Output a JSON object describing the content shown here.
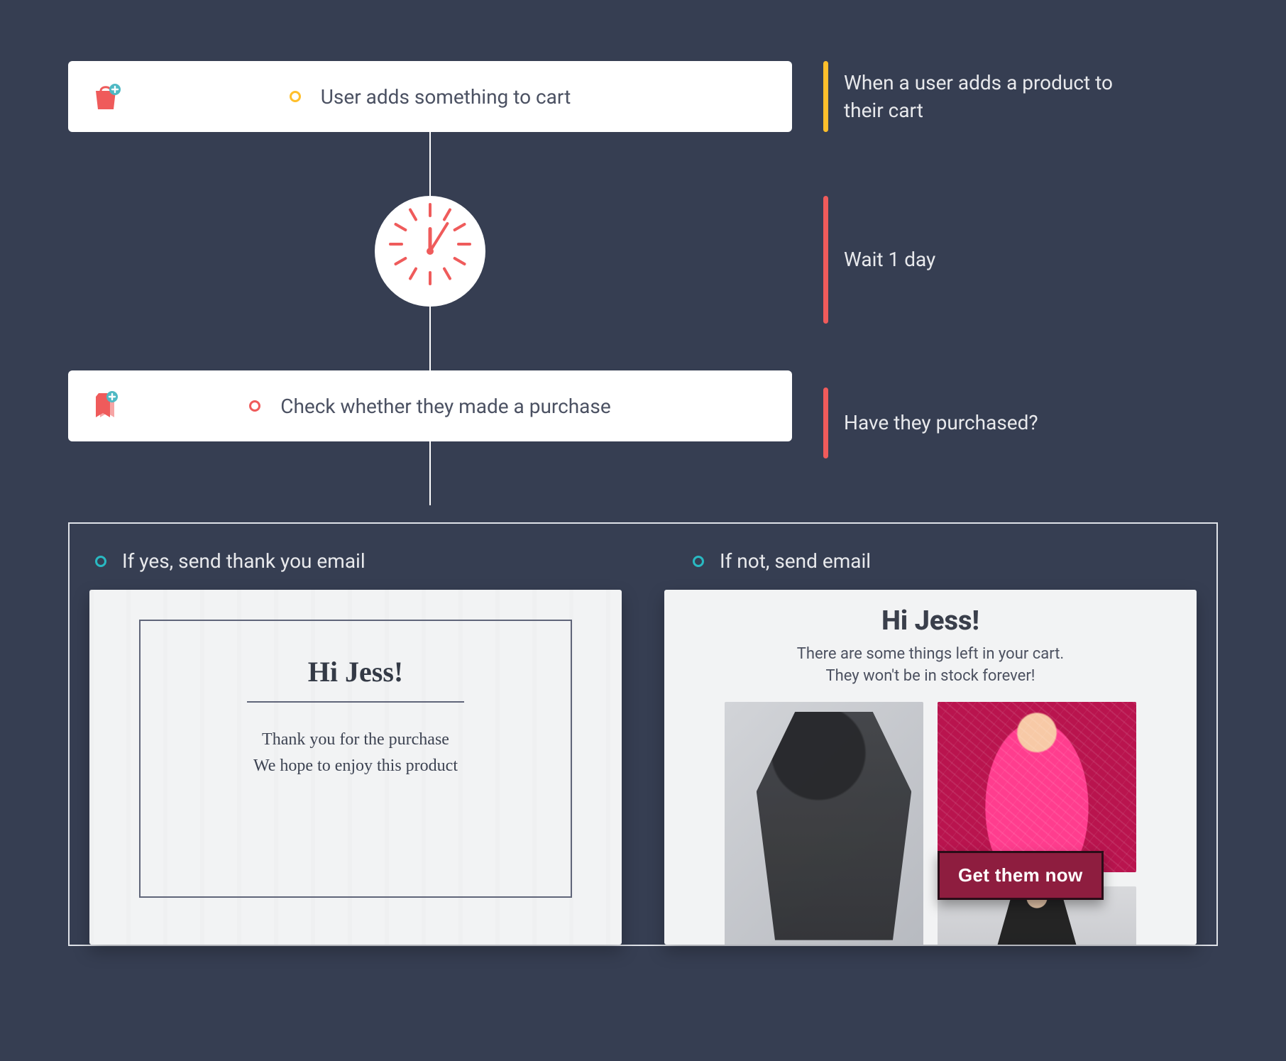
{
  "flow": {
    "trigger": {
      "bullet_color": "yellow",
      "icon": "shopping-bag-add-icon",
      "label": "User adds something to cart"
    },
    "wait": {
      "label": "Wait 1 day"
    },
    "condition": {
      "bullet_color": "red",
      "icon": "tag-check-icon",
      "label": "Check whether they made a purchase"
    }
  },
  "annotations": {
    "trigger": "When a user adds a product to their cart",
    "wait": "Wait 1 day",
    "condition": "Have they purchased?"
  },
  "branches": {
    "yes": {
      "bullet_color": "teal",
      "label": "If yes, send thank you email",
      "email": {
        "greeting": "Hi Jess!",
        "line1": "Thank you for the purchase",
        "line2": "We hope to enjoy this product"
      }
    },
    "no": {
      "bullet_color": "teal",
      "label": "If not, send email",
      "email": {
        "greeting": "Hi Jess!",
        "sub1": "There are some things left in your cart.",
        "sub2": "They won't be in stock forever!",
        "cta": "Get them now"
      }
    }
  },
  "colors": {
    "bg": "#363e52",
    "yellow": "#ffbf2b",
    "red": "#ef5b5b",
    "teal": "#29b9c2",
    "cta": "#8e1d3f"
  }
}
